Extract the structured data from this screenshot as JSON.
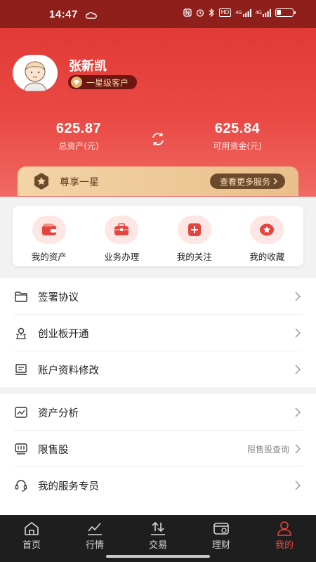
{
  "status_bar": {
    "time": "14:47",
    "hd_label": "HD",
    "signal_1": "4G",
    "signal_2": "4G",
    "battery_percent": 30
  },
  "profile": {
    "name": "张新凯",
    "level": "一星级客户"
  },
  "assets": {
    "total_value": "625.87",
    "total_label": "总资产(元)",
    "available_value": "625.84",
    "available_label": "可用资金(元)"
  },
  "vip": {
    "title": "尊享一星",
    "more_label": "查看更多服务"
  },
  "quick_menu": [
    {
      "label": "我的资产",
      "icon": "wallet-icon"
    },
    {
      "label": "业务办理",
      "icon": "briefcase-icon"
    },
    {
      "label": "我的关注",
      "icon": "plus-square-icon"
    },
    {
      "label": "我的收藏",
      "icon": "star-icon"
    }
  ],
  "list_a": [
    {
      "label": "签署协议",
      "icon": "folder-icon"
    },
    {
      "label": "创业板开通",
      "icon": "map-pin-icon"
    },
    {
      "label": "账户资料修改",
      "icon": "id-card-icon"
    }
  ],
  "list_b": [
    {
      "label": "资产分析",
      "icon": "chart-icon",
      "sub": ""
    },
    {
      "label": "限售股",
      "icon": "restricted-stock-icon",
      "sub": "限售股查询"
    },
    {
      "label": "我的服务专员",
      "icon": "headset-icon",
      "sub": ""
    }
  ],
  "bottom_nav": [
    {
      "label": "首页",
      "icon": "home-icon"
    },
    {
      "label": "行情",
      "icon": "market-icon"
    },
    {
      "label": "交易",
      "icon": "trade-icon"
    },
    {
      "label": "理财",
      "icon": "finance-icon"
    },
    {
      "label": "我的",
      "icon": "user-icon"
    }
  ],
  "colors": {
    "primary_red": "#e13a36",
    "status_bar": "#8e1f1a",
    "gold": "#e9bf8b",
    "nav_active": "#e5453e",
    "nav_bg": "#1e1e1e"
  }
}
